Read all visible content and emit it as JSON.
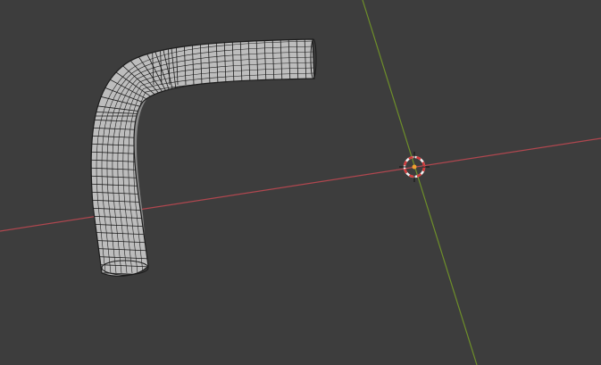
{
  "viewport": {
    "background_color": "#3d3d3d",
    "x_axis_color": "#b0474f",
    "y_axis_color": "#6e8f2a"
  },
  "mesh": {
    "type": "bent-pipe",
    "fill_color": "#bdbdbd",
    "wire_color": "#1c1c1c",
    "shadow_color": "#8a8a8a"
  },
  "cursor_3d": {
    "icon": "3d-cursor-icon",
    "ring_red": "#d23a3a",
    "ring_white": "#f2f2f2",
    "origin_color": "#f0a030"
  }
}
